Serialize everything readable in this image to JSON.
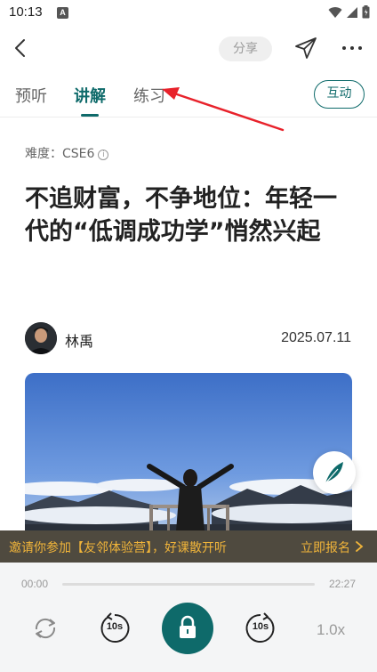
{
  "status_bar": {
    "time": "10:13",
    "notification_letter": "A"
  },
  "nav": {
    "share_label": "分享"
  },
  "tabs": [
    {
      "label": "预听"
    },
    {
      "label": "讲解"
    },
    {
      "label": "练习"
    }
  ],
  "interact_label": "互动",
  "article": {
    "difficulty": "难度：CSE6",
    "title": "不追财富，不争地位：年轻一代的“低调成功学”悄然兴起",
    "author": "林禹",
    "date": "2025.07.11"
  },
  "banner": {
    "text": "邀请你参加【友邻体验营】，好课散开听",
    "cta": "立即报名"
  },
  "player": {
    "elapsed": "00:00",
    "duration": "22:27",
    "progress": 0,
    "rewind_label": "10s",
    "forward_label": "10s",
    "speed": "1.0x"
  },
  "colors": {
    "accent": "#0e6a6a",
    "banner_bg": "#4f4a3f",
    "banner_text": "#f0b43a",
    "annotation": "#e8222b"
  },
  "icons": [
    "back-arrow-icon",
    "send-icon",
    "more-icon",
    "info-icon",
    "feather-pen-icon",
    "chevron-right-icon",
    "repeat-icon",
    "rewind-10-icon",
    "lock-icon",
    "forward-10-icon",
    "wifi-icon",
    "signal-icon",
    "battery-icon"
  ]
}
